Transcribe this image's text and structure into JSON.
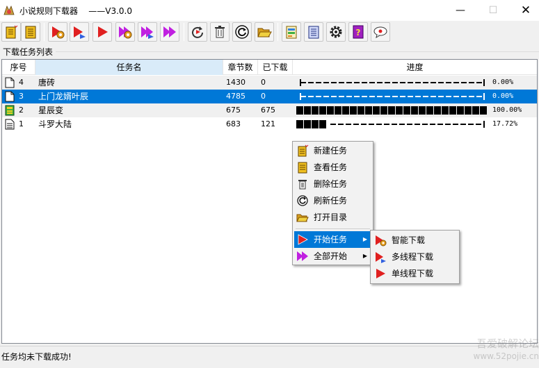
{
  "window": {
    "title": "小说规则下载器    ——V3.0.0",
    "minimize_icon": "minimize-icon",
    "maximize_icon": "maximize-icon",
    "close_icon": "close-icon"
  },
  "toolbar": {
    "buttons": [
      {
        "icon": "new-task-icon"
      },
      {
        "icon": "view-task-icon"
      },
      {
        "icon": "smart-download-icon"
      },
      {
        "icon": "multithread-download-icon"
      },
      {
        "icon": "single-thread-download-icon"
      },
      {
        "icon": "smart-download-all-icon"
      },
      {
        "icon": "multithread-download-all-icon"
      },
      {
        "icon": "download-all-icon"
      },
      {
        "icon": "refresh-icon"
      },
      {
        "icon": "delete-icon"
      },
      {
        "icon": "reload-icon"
      },
      {
        "icon": "open-folder-icon"
      },
      {
        "icon": "rules-icon"
      },
      {
        "icon": "notes-icon"
      },
      {
        "icon": "settings-icon"
      },
      {
        "icon": "help-icon"
      },
      {
        "icon": "about-icon"
      }
    ]
  },
  "group": {
    "label": "下载任务列表"
  },
  "table": {
    "columns": [
      "序号",
      "任务名",
      "章节数",
      "已下载",
      "进度"
    ],
    "rows": [
      {
        "index": "4",
        "name": "唐砖",
        "chapters": "1430",
        "downloaded": "0",
        "progress": 0.0,
        "progress_text": "0.00%",
        "icon": "document-icon",
        "selected": false
      },
      {
        "index": "3",
        "name": "上门龙婿叶辰",
        "chapters": "4785",
        "downloaded": "0",
        "progress": 0.0,
        "progress_text": "0.00%",
        "icon": "document-icon",
        "selected": true
      },
      {
        "index": "2",
        "name": "星辰变",
        "chapters": "675",
        "downloaded": "675",
        "progress": 1.0,
        "progress_text": "100.00%",
        "icon": "book-complete-icon",
        "selected": false
      },
      {
        "index": "1",
        "name": "斗罗大陆",
        "chapters": "683",
        "downloaded": "121",
        "progress": 0.1772,
        "progress_text": "17.72%",
        "icon": "document-lines-icon",
        "selected": false
      }
    ]
  },
  "context_menu": {
    "items": [
      {
        "label": "新建任务",
        "icon": "new-task-icon"
      },
      {
        "label": "查看任务",
        "icon": "view-task-icon"
      },
      {
        "label": "删除任务",
        "icon": "delete-icon"
      },
      {
        "label": "刷新任务",
        "icon": "refresh-icon"
      },
      {
        "label": "打开目录",
        "icon": "open-folder-icon"
      },
      {
        "label": "开始任务",
        "icon": "start-icon",
        "has_submenu": true,
        "highlighted": true
      },
      {
        "label": "全部开始",
        "icon": "start-all-icon",
        "has_submenu": true,
        "highlighted": false
      }
    ],
    "submenu": [
      {
        "label": "智能下载",
        "icon": "smart-download-icon"
      },
      {
        "label": "多线程下载",
        "icon": "multithread-download-icon"
      },
      {
        "label": "单线程下载",
        "icon": "single-thread-download-icon"
      }
    ]
  },
  "status": {
    "text": "任务均未下载成功!"
  },
  "watermark": {
    "line1": "吾爱破解论坛",
    "line2": "www.52pojie.cn"
  },
  "colors": {
    "selection": "#0078d7",
    "play_red": "#e02020",
    "play_purple": "#c020e0",
    "gear_orange": "#e8a020"
  }
}
